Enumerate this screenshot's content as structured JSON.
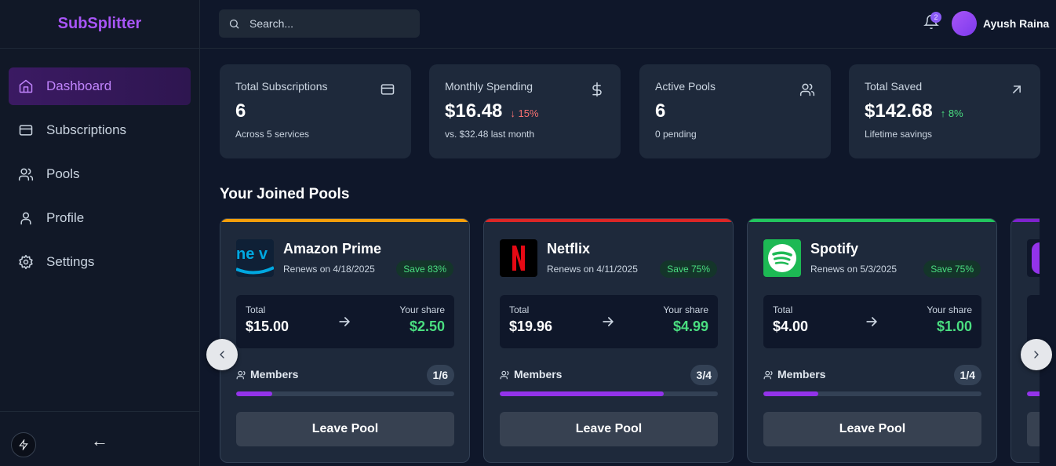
{
  "app": {
    "brand": "SubSplitter"
  },
  "sidebar": {
    "items": [
      {
        "label": "Dashboard",
        "icon": "home-icon",
        "active": true
      },
      {
        "label": "Subscriptions",
        "icon": "credit-card-icon",
        "active": false
      },
      {
        "label": "Pools",
        "icon": "users-icon",
        "active": false
      },
      {
        "label": "Profile",
        "icon": "user-icon",
        "active": false
      },
      {
        "label": "Settings",
        "icon": "gear-icon",
        "active": false
      }
    ],
    "collapse_label": "←"
  },
  "header": {
    "search_placeholder": "Search...",
    "notification_count": "2",
    "user_name": "Ayush Raina"
  },
  "stats": [
    {
      "title": "Total Subscriptions",
      "value": "6",
      "change": "",
      "sub": "Across 5 services",
      "icon": "credit-card-icon"
    },
    {
      "title": "Monthly Spending",
      "value": "$16.48",
      "change": "↓ 15%",
      "sub": "vs. $32.48 last month",
      "icon": "dollar-icon"
    },
    {
      "title": "Active Pools",
      "value": "6",
      "change": "",
      "sub": "0 pending",
      "icon": "users-icon"
    },
    {
      "title": "Total Saved",
      "value": "$142.68",
      "change": "↑ 8%",
      "sub": "Lifetime savings",
      "icon": "arrow-up-right-icon"
    }
  ],
  "pools_section": {
    "title": "Your Joined Pools",
    "total_label": "Total",
    "share_label": "Your share",
    "members_label": "Members",
    "leave_label": "Leave Pool",
    "pools": [
      {
        "name": "Amazon Prime",
        "renews": "Renews on 4/18/2025",
        "save": "Save 83%",
        "total": "$15.00",
        "share": "$2.50",
        "members": "1/6",
        "fill": 0.1667,
        "accent": "#f59e0b",
        "logo": "amazon-prime-logo-icon",
        "logo_text": "ne v"
      },
      {
        "name": "Netflix",
        "renews": "Renews on 4/11/2025",
        "save": "Save 75%",
        "total": "$19.96",
        "share": "$4.99",
        "members": "3/4",
        "fill": 0.75,
        "accent": "#dc2626",
        "logo": "netflix-logo-icon",
        "logo_text": "N"
      },
      {
        "name": "Spotify",
        "renews": "Renews on 5/3/2025",
        "save": "Save 75%",
        "total": "$4.00",
        "share": "$1.00",
        "members": "1/4",
        "fill": 0.25,
        "accent": "#22c55e",
        "logo": "spotify-logo-icon",
        "logo_text": ""
      },
      {
        "name": "",
        "renews": "",
        "save": "",
        "total": "",
        "share": "",
        "members": "",
        "fill": 0.1,
        "accent": "#7e22ce",
        "logo": "app-logo-icon",
        "logo_text": ""
      }
    ]
  }
}
